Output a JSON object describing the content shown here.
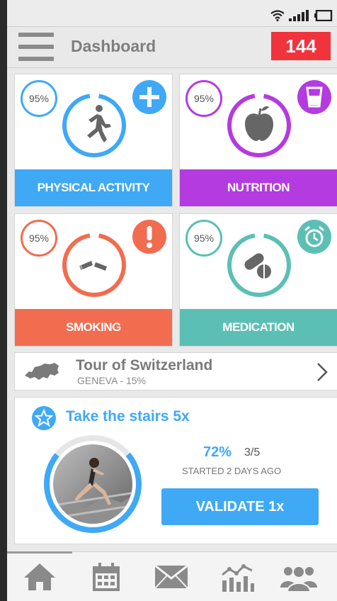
{
  "header": {
    "title": "Dashboard",
    "count": "144"
  },
  "tiles": [
    {
      "label": "PHYSICAL ACTIVITY",
      "percent": "95%",
      "progress": 0.95,
      "color": "#3fa9f5",
      "ring_icon": "running-person-icon",
      "action_icon": "plus-icon"
    },
    {
      "label": "NUTRITION",
      "percent": "95%",
      "progress": 0.95,
      "color": "#b43be0",
      "ring_icon": "apple-icon",
      "action_icon": "glass-of-water-icon"
    },
    {
      "label": "SMOKING",
      "percent": "95%",
      "progress": 0.95,
      "color": "#f26c4f",
      "ring_icon": "broken-cigarette-icon",
      "action_icon": "exclamation-icon"
    },
    {
      "label": "MEDICATION",
      "percent": "95%",
      "progress": 0.95,
      "color": "#5cbfb5",
      "ring_icon": "pills-icon",
      "action_icon": "alarm-clock-icon"
    }
  ],
  "tour": {
    "title": "Tour of Switzerland",
    "subtitle": "GENEVA - 15%",
    "progress": 0.15
  },
  "challenge": {
    "title": "Take the stairs 5x",
    "progress_pct": "72%",
    "progress": 0.72,
    "steps": "3/5",
    "started": "STARTED 2 DAYS AGO",
    "validate_label": "VALIDATE 1x"
  },
  "nav": {
    "items": [
      "home-icon",
      "calendar-icon",
      "mail-icon",
      "stats-icon",
      "community-icon"
    ],
    "active": 0
  },
  "colors": {
    "accent": "#3fa9f5",
    "badge": "#f1333c"
  }
}
